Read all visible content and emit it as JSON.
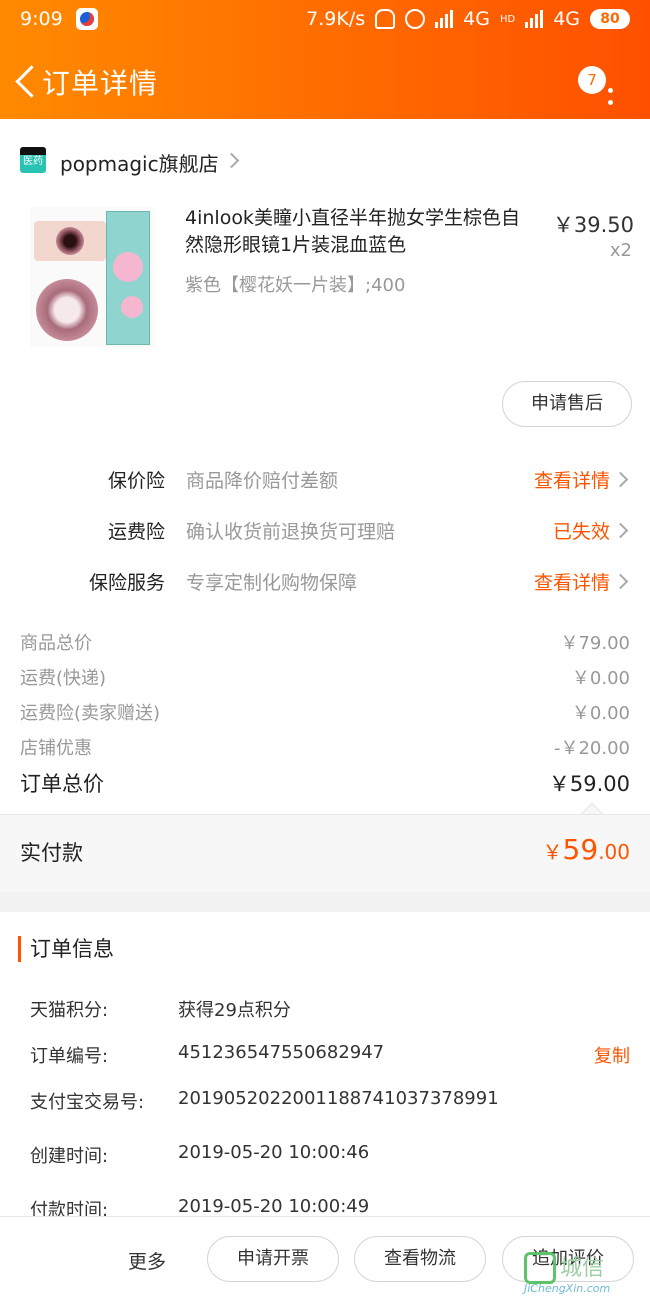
{
  "status_bar": {
    "time": "9:09",
    "network_speed": "7.9K/s",
    "network_1": "4G",
    "network_2": "4G",
    "hd_label": "HD",
    "battery": "80"
  },
  "header": {
    "title": "订单详情",
    "notification_count": "7"
  },
  "shop": {
    "logo_text": "医药",
    "name": "popmagic旗舰店"
  },
  "product": {
    "title": "4inlook美瞳小直径半年抛女学生棕色自然隐形眼镜1片装混血蓝色",
    "sku": "紫色【樱花妖一片装】;400",
    "price": "￥39.50",
    "quantity": "x2",
    "after_sale_label": "申请售后"
  },
  "insurance": [
    {
      "label": "保价险",
      "desc": "商品降价赔付差额",
      "link": "查看详情"
    },
    {
      "label": "运费险",
      "desc": "确认收货前退换货可理赔",
      "link": "已失效"
    },
    {
      "label": "保险服务",
      "desc": "专享定制化购物保障",
      "link": "查看详情"
    }
  ],
  "summary": [
    {
      "label": "商品总价",
      "value": "￥79.00"
    },
    {
      "label": "运费(快递)",
      "value": "￥0.00"
    },
    {
      "label": "运费险(卖家赠送)",
      "value": "￥0.00"
    },
    {
      "label": "店铺优惠",
      "value": "-￥20.00"
    }
  ],
  "order_total": {
    "label": "订单总价",
    "value": "￥59.00"
  },
  "payment": {
    "label": "实付款",
    "currency": "￥",
    "amount_int": "59",
    "amount_dec": ".00"
  },
  "order_info": {
    "title": "订单信息",
    "rows": [
      {
        "key": "天猫积分:",
        "value": "获得29点积分"
      },
      {
        "key": "订单编号:",
        "value": "451236547550682947"
      },
      {
        "key": "支付宝交易号:",
        "value": "2019052022001188741037378991"
      },
      {
        "key": "创建时间:",
        "value": "2019-05-20 10:00:46"
      },
      {
        "key": "付款时间:",
        "value": "2019-05-20 10:00:49"
      }
    ],
    "copy_label": "复制"
  },
  "bottom_bar": {
    "more_label": "更多",
    "invoice_label": "申请开票",
    "logistics_label": "查看物流",
    "review_label": "追加评价"
  },
  "watermark": {
    "text": "城信",
    "url": "JiChengXin.com"
  },
  "colors": {
    "accent": "#ff5500",
    "header_start": "#ff8a00",
    "header_end": "#ff5000"
  }
}
